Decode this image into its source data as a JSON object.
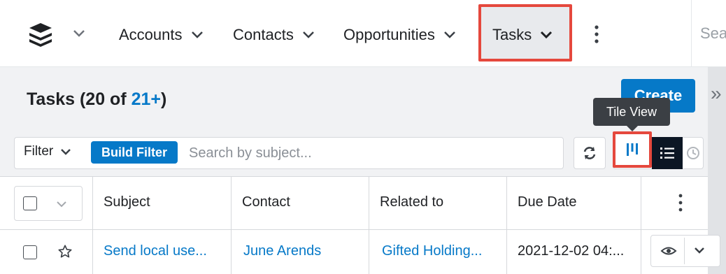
{
  "nav": {
    "logo_icon": "sugar-cube-stack-icon",
    "items": [
      {
        "label": "Accounts"
      },
      {
        "label": "Contacts"
      },
      {
        "label": "Opportunities"
      },
      {
        "label": "Tasks"
      }
    ],
    "more_icon": "kebab-icon",
    "search_placeholder": "Search"
  },
  "header": {
    "title_prefix": "Tasks (20 of ",
    "title_count": "21+",
    "title_suffix": ")",
    "create_label": "Create",
    "tooltip": "Tile View"
  },
  "filterbar": {
    "filter_label": "Filter",
    "build_filter_label": "Build Filter",
    "search_placeholder": "Search by subject..."
  },
  "table": {
    "columns": [
      "Subject",
      "Contact",
      "Related to",
      "Due Date"
    ],
    "rows": [
      {
        "subject": "Send local use...",
        "contact": "June Arends",
        "related_to": "Gifted Holding...",
        "due_date": "2021-12-02 04:..."
      }
    ]
  },
  "colors": {
    "accent": "#0679c8",
    "highlight": "#e5483d",
    "nav_text": "#1f2124"
  }
}
